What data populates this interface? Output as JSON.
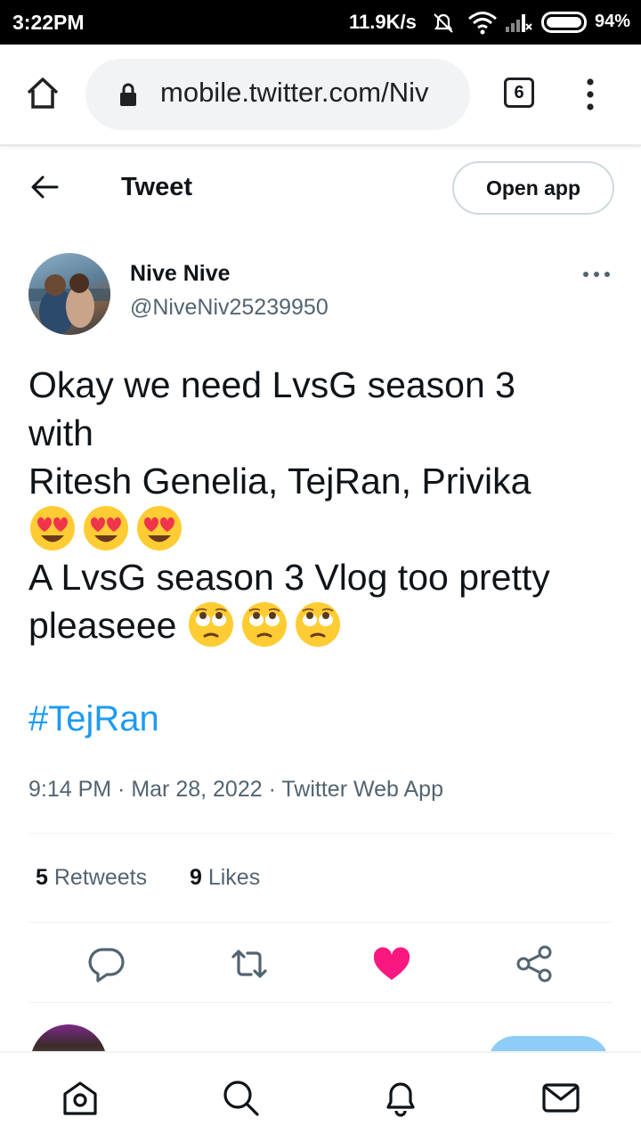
{
  "status_bar": {
    "time": "3:22PM",
    "network_speed": "11.9K/s",
    "battery": "94%"
  },
  "browser": {
    "url": "mobile.twitter.com/Niv",
    "tab_count": "6"
  },
  "header": {
    "title": "Tweet",
    "open_app_label": "Open app"
  },
  "tweet": {
    "author_name": "Nive Nive",
    "author_handle": "@NiveNiv25239950",
    "lines": {
      "l1": "Okay we need LvsG season 3",
      "l2": "with",
      "l3": "Ritesh Genelia, TejRan, Privika",
      "l5": "A LvsG season 3 Vlog too pretty",
      "l6": "pleaseee "
    },
    "hashtag": "#TejRan",
    "meta": "9:14 PM · Mar 28, 2022 · Twitter Web App",
    "retweets_count": "5",
    "retweets_label": "Retweets",
    "likes_count": "9",
    "likes_label": "Likes"
  },
  "colors": {
    "link": "#1d9bf0",
    "like": "#f91880",
    "secondary_text": "#536471"
  },
  "icons": {
    "actions": [
      "reply-icon",
      "retweet-icon",
      "like-icon",
      "share-icon"
    ],
    "nav": [
      "home-icon",
      "search-icon",
      "notifications-icon",
      "messages-icon"
    ],
    "emoji": [
      "heart-eyes-emoji",
      "rolling-eyes-emoji"
    ]
  }
}
